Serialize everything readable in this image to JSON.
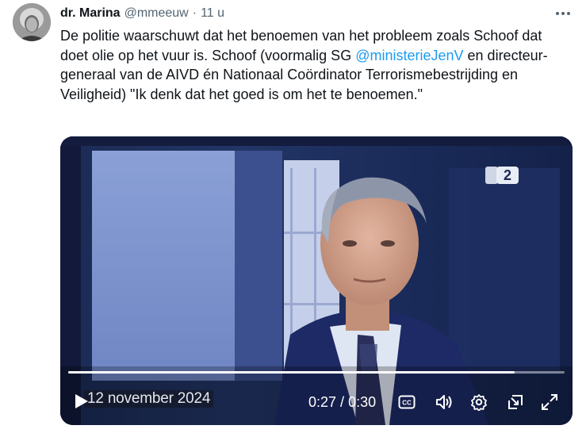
{
  "tweet": {
    "author_name": "dr. Marina",
    "author_handle": "@mmeeuw",
    "separator": "·",
    "time": "11 u",
    "text_before_mention": "De politie waarschuwt dat het benoemen van het probleem zoals Schoof dat doet olie op het vuur is. Schoof (voormalig SG ",
    "mention": "@ministerieJenV",
    "text_after_mention": " en directeur-generaal van de AIVD én Nationaal Coördinator Terrorismebestrijding en Veiligheid) \"Ik denk dat het goed is om het te benoemen.\""
  },
  "video": {
    "caption": "12 november 2024",
    "current_time": "0:27",
    "time_separator": " / ",
    "duration": "0:30",
    "progress_fraction": 0.9,
    "channel_logo_text": "2"
  },
  "colors": {
    "mention": "#1d9bf0",
    "secondary_text": "#536471"
  },
  "icons": [
    "more-icon",
    "play-icon",
    "captions-icon",
    "volume-icon",
    "settings-icon",
    "pip-icon",
    "fullscreen-icon"
  ]
}
